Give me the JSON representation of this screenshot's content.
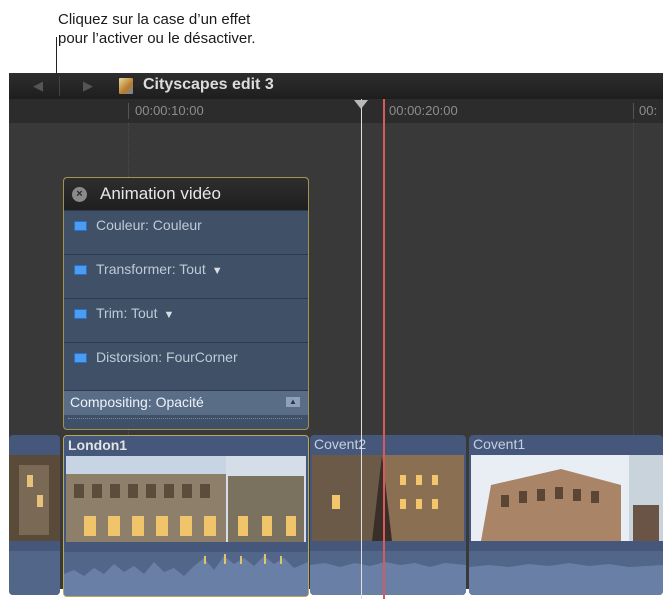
{
  "callout": {
    "line1": "Cliquez sur la case d’un effet",
    "line2": "pour l’activer ou le désactiver."
  },
  "titlebar": {
    "back_icon": "◀",
    "forward_icon": "▶",
    "project_title": "Cityscapes edit 3"
  },
  "ruler": {
    "ticks": [
      "00:00:10:00",
      "00:00:20:00",
      "00:"
    ]
  },
  "effects_panel": {
    "title": "Animation vidéo",
    "close_icon": "×",
    "effects": [
      {
        "label": "Couleur: Couleur",
        "has_menu": false
      },
      {
        "label": "Transformer: Tout",
        "has_menu": true
      },
      {
        "label": "Trim: Tout",
        "has_menu": true
      },
      {
        "label": "Distorsion: FourCorner",
        "has_menu": false
      }
    ],
    "menu_arrow": "▼",
    "compositing_label": "Compositing: Opacité",
    "compositing_toggle": "▲"
  },
  "clips": [
    {
      "name": "London1"
    },
    {
      "name": "Covent2"
    },
    {
      "name": "Covent1"
    }
  ],
  "colors": {
    "accent_checkbox": "#4a9cf5",
    "clip_blue": "#45577a",
    "skimmer_red": "#d95a5a"
  }
}
